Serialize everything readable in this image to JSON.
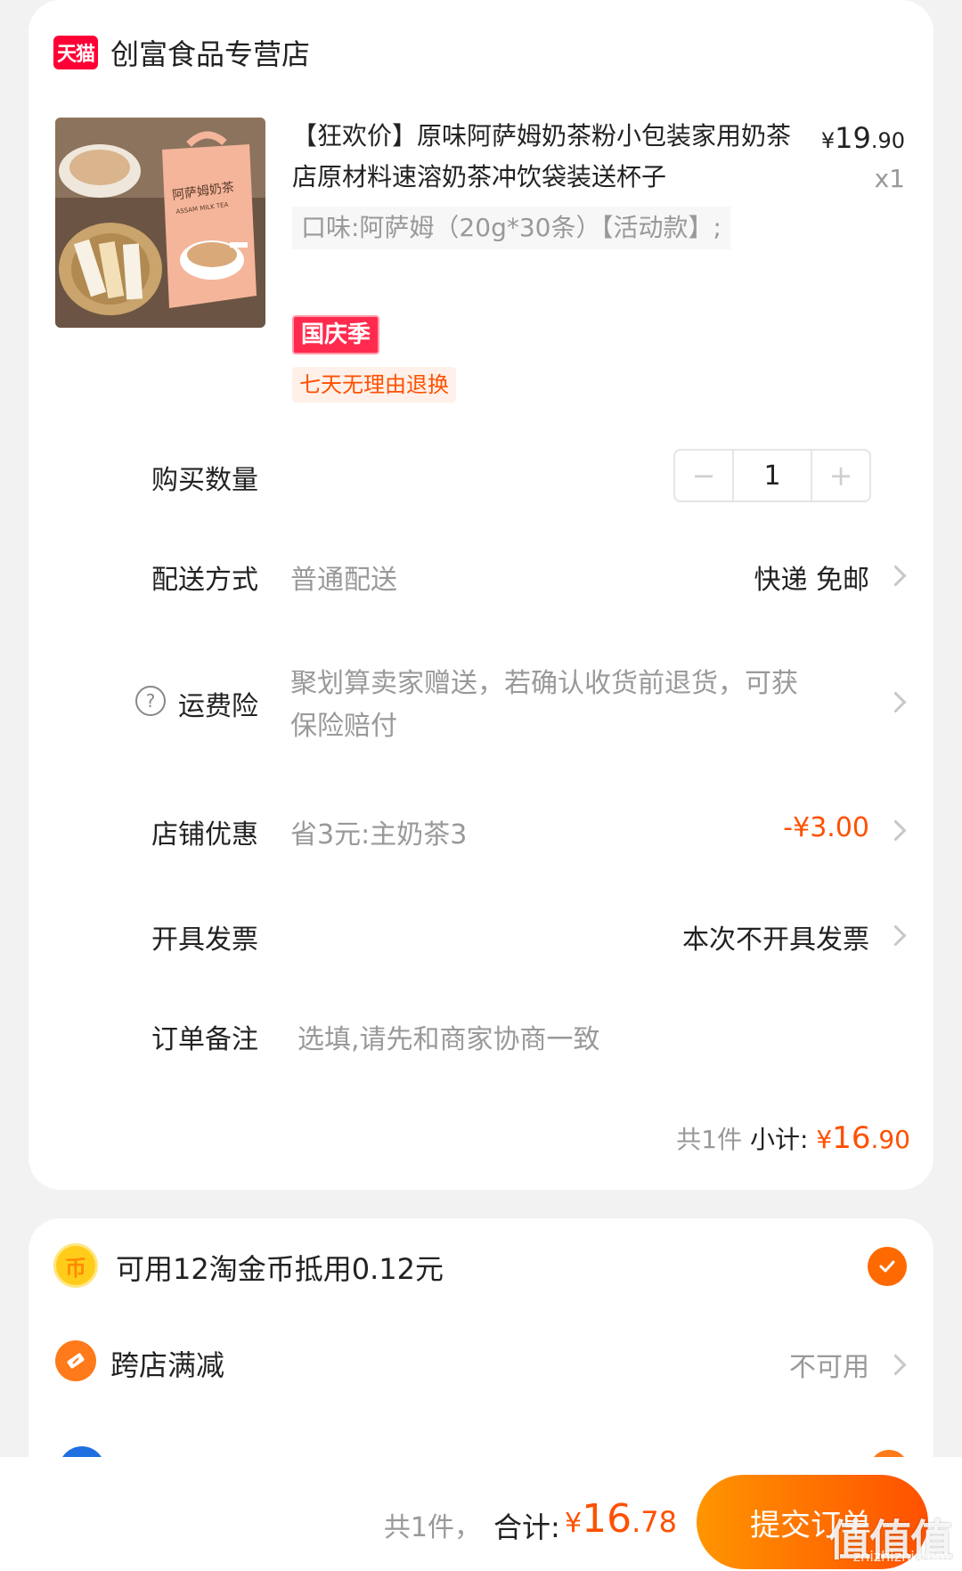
{
  "shop": {
    "logo_text": "天猫",
    "name": "创富食品专营店"
  },
  "product": {
    "title": "【狂欢价】原味阿萨姆奶茶粉小包装家用奶茶店原材料速溶奶茶冲饮袋装送杯子",
    "price_currency": "¥",
    "price_int": "19",
    "price_dec": ".90",
    "quantity": "x1",
    "sku": "口味:阿萨姆（20g*30条）【活动款】;",
    "promo_tag": "国庆季",
    "return_tag": "七天无理由退换",
    "image_label": "阿萨姆奶茶",
    "image_sub": "ASSAM MILK TEA"
  },
  "rows": {
    "qty_label": "购买数量",
    "qty_minus": "−",
    "qty_value": "1",
    "qty_plus": "+",
    "delivery_label": "配送方式",
    "delivery_desc": "普通配送",
    "delivery_value": "快递 免邮",
    "insurance_label": "运费险",
    "insurance_icon": "?",
    "insurance_desc_line1": "聚划算卖家赠送，若确认收货前退货，可获",
    "insurance_desc_line2": "保险赔付",
    "discount_label": "店铺优惠",
    "discount_desc": "省3元:主奶茶3",
    "discount_value": "-¥3.00",
    "invoice_label": "开具发票",
    "invoice_value": "本次不开具发票",
    "note_label": "订单备注",
    "note_placeholder": "选填,请先和商家协商一致"
  },
  "subtotal": {
    "count": "共1件",
    "label": "小计:",
    "currency": "¥",
    "int": "16",
    "dec": ".90"
  },
  "benefits": {
    "coin_icon": "币",
    "coin_text": "可用12淘金币抵用0.12元",
    "coin_checked": true,
    "cross_text": "跨店满减",
    "cross_status": "不可用"
  },
  "footer": {
    "count": "共1件，",
    "total_label": "合计:",
    "currency": "¥",
    "total_int": "16",
    "total_dec": ".78",
    "submit_label": "提交订单",
    "watermark": "值值值",
    "watermark_sub": "zhizhizhi.com"
  },
  "colors": {
    "accent": "#ff5000",
    "tmall_red": "#ff0036",
    "muted": "#999999"
  }
}
